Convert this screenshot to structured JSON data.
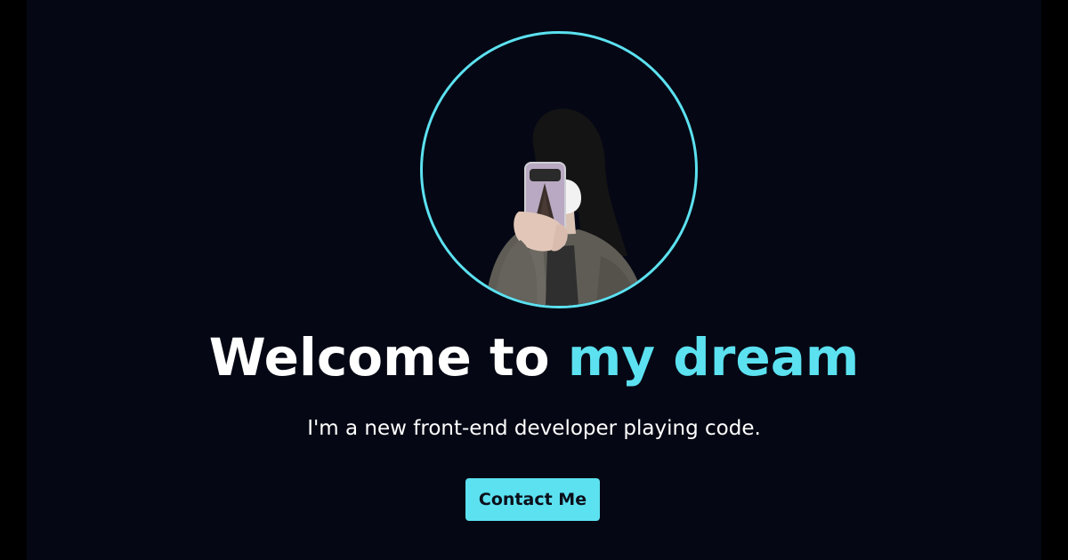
{
  "hero": {
    "title_prefix": "Welcome to ",
    "title_accent": "my dream",
    "subtitle": "I'm a new front-end developer playing code.",
    "contact_button_label": "Contact Me"
  },
  "colors": {
    "background": "#050814",
    "outer_background": "#000000",
    "accent": "#5ce1f0",
    "text": "#ffffff",
    "button_text": "#0b0f1a"
  },
  "avatar": {
    "icon": "profile-photo"
  }
}
